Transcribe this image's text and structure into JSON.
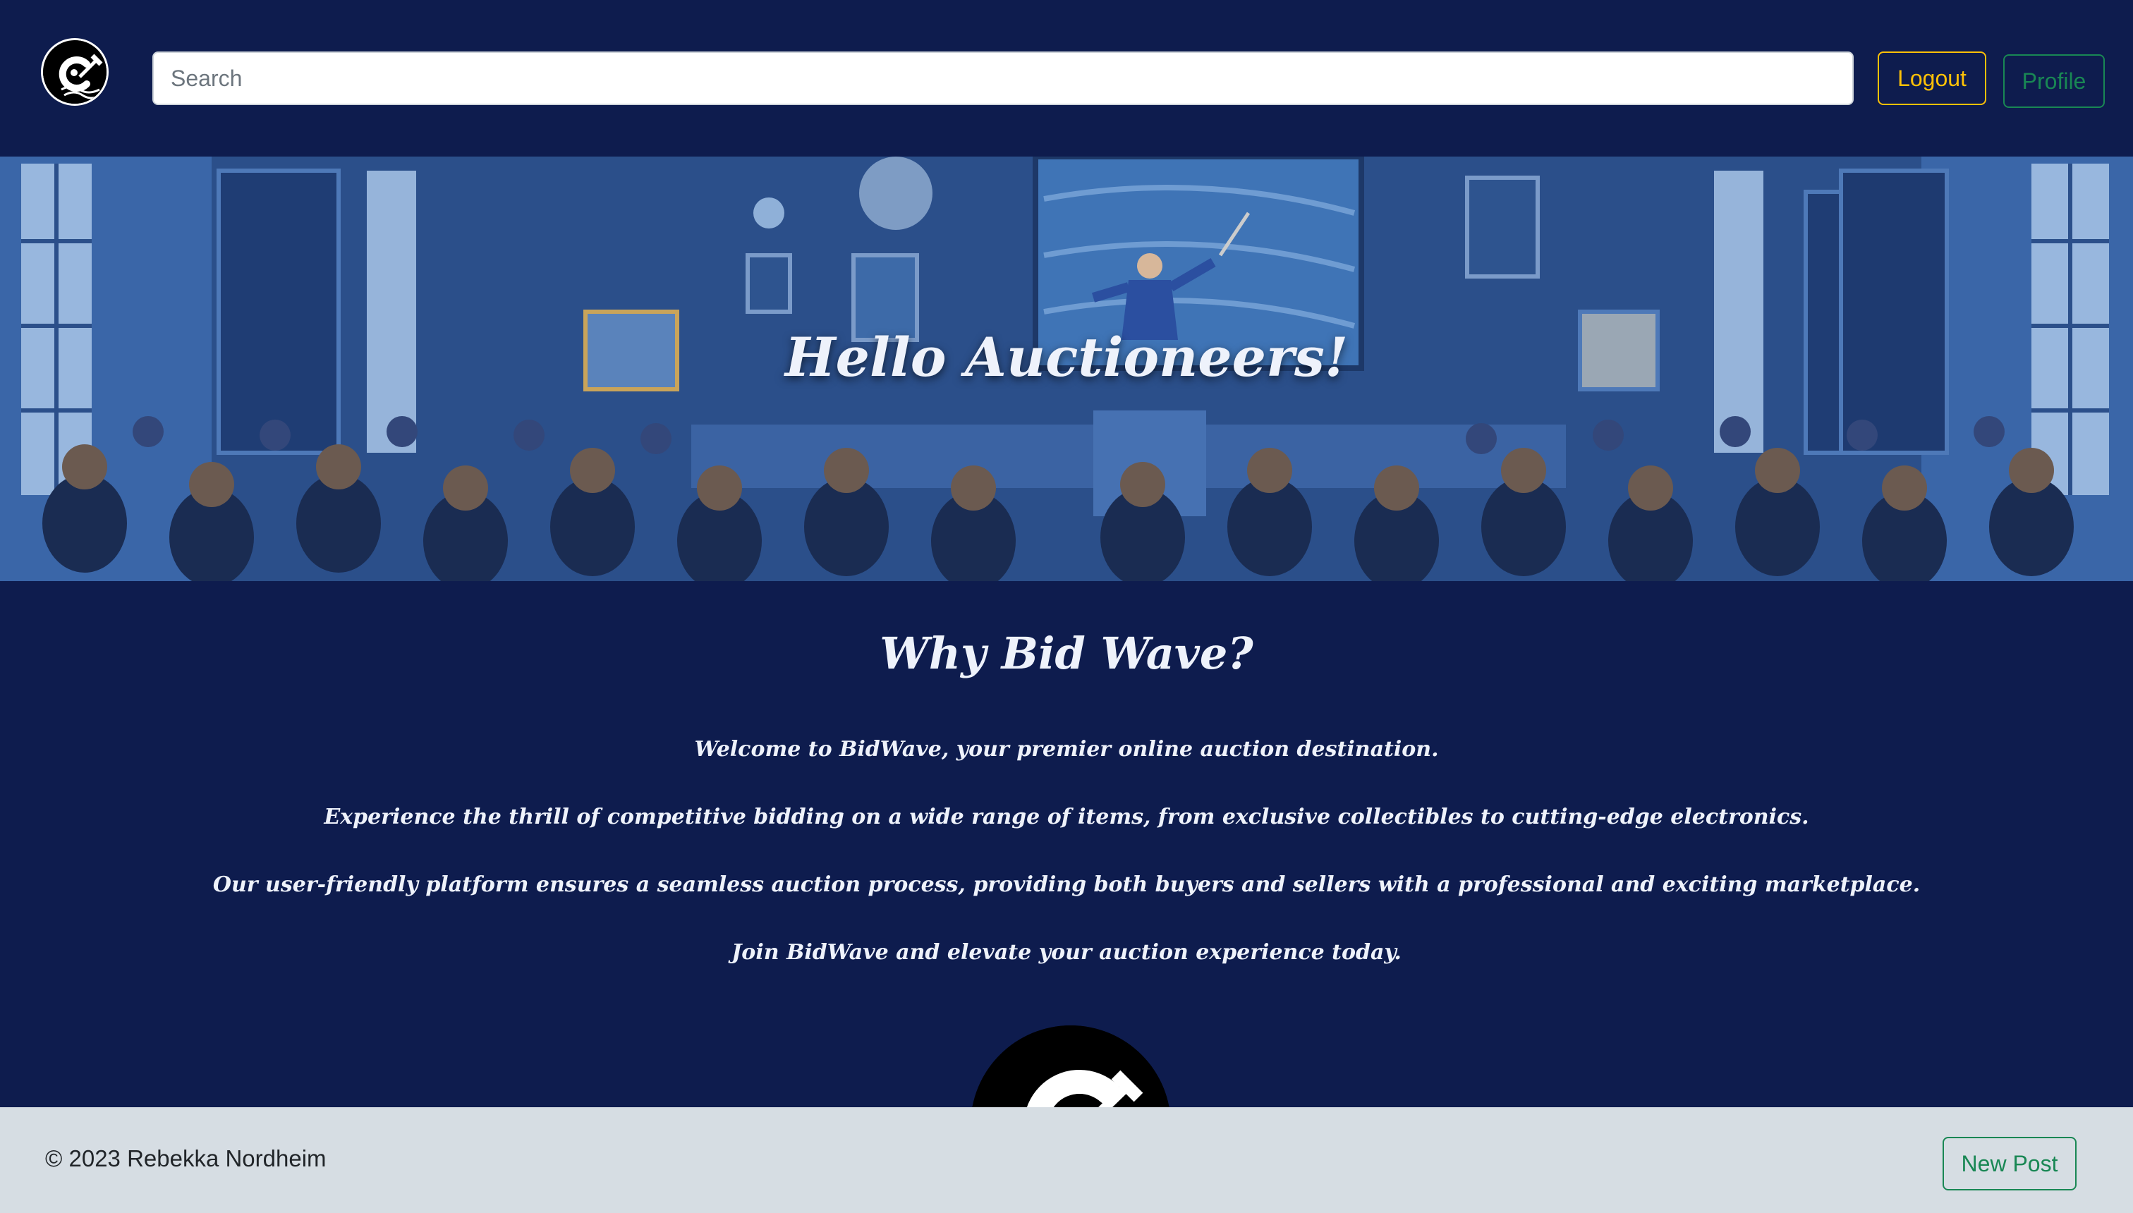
{
  "header": {
    "logo_icon": "bidwave-logo-icon",
    "search_placeholder": "Search",
    "logout_label": "Logout",
    "profile_label": "Profile"
  },
  "hero": {
    "title": "Hello Auctioneers!",
    "image": "auction-hall-illustration"
  },
  "about": {
    "title": "Why Bid Wave?",
    "paragraphs": [
      "Welcome to BidWave, your premier online auction destination.",
      "Experience the thrill of competitive bidding on a wide range of items, from exclusive collectibles to cutting-edge electronics.",
      "Our user-friendly platform ensures a seamless auction process, providing both buyers and sellers with a professional and exciting marketplace.",
      "Join BidWave and elevate your auction experience today."
    ]
  },
  "footer": {
    "copyright": "© 2023 Rebekka Nordheim",
    "new_post_label": "New Post"
  },
  "colors": {
    "background": "#0e1c4e",
    "footer": "#d6dde3",
    "warning": "#ffc107",
    "success": "#198754"
  }
}
